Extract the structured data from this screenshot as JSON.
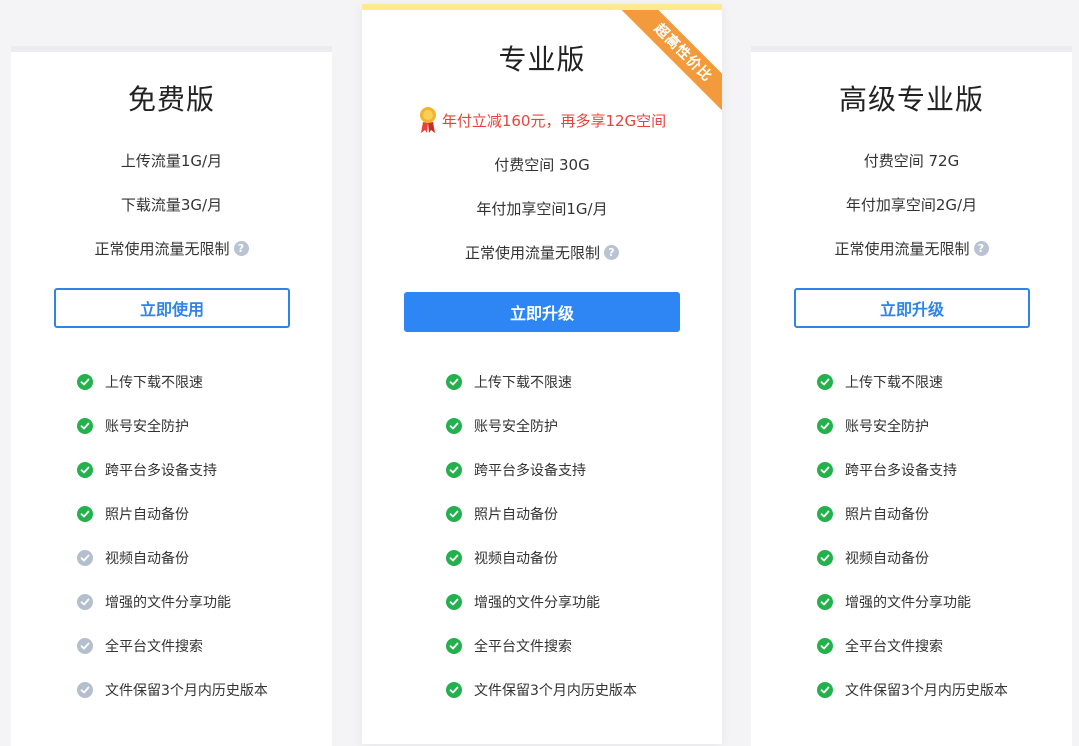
{
  "colors": {
    "accent": "#2e86f5",
    "check_on": "#22b14c",
    "check_off": "#b4bfcd",
    "promo": "#e8423a",
    "ribbon": "#f39a3c",
    "mid_top_border": "#fde98f"
  },
  "plans": [
    {
      "title": "免费版",
      "lines": [
        "上传流量1G/月",
        "下载流量3G/月",
        "正常使用流量无限制"
      ],
      "button": "立即使用",
      "features": [
        {
          "label": "上传下载不限速",
          "included": true
        },
        {
          "label": "账号安全防护",
          "included": true
        },
        {
          "label": "跨平台多设备支持",
          "included": true
        },
        {
          "label": "照片自动备份",
          "included": true
        },
        {
          "label": "视频自动备份",
          "included": false
        },
        {
          "label": "增强的文件分享功能",
          "included": false
        },
        {
          "label": "全平台文件搜索",
          "included": false
        },
        {
          "label": "文件保留3个月内历史版本",
          "included": false
        }
      ]
    },
    {
      "title": "专业版",
      "ribbon": "超高性价比",
      "promo": "年付立减160元，再多享12G空间",
      "lines": [
        "付费空间 30G",
        "年付加享空间1G/月",
        "正常使用流量无限制"
      ],
      "button": "立即升级",
      "features": [
        {
          "label": "上传下载不限速",
          "included": true
        },
        {
          "label": "账号安全防护",
          "included": true
        },
        {
          "label": "跨平台多设备支持",
          "included": true
        },
        {
          "label": "照片自动备份",
          "included": true
        },
        {
          "label": "视频自动备份",
          "included": true
        },
        {
          "label": "增强的文件分享功能",
          "included": true
        },
        {
          "label": "全平台文件搜索",
          "included": true
        },
        {
          "label": "文件保留3个月内历史版本",
          "included": true
        }
      ]
    },
    {
      "title": "高级专业版",
      "lines": [
        "付费空间 72G",
        "年付加享空间2G/月",
        "正常使用流量无限制"
      ],
      "button": "立即升级",
      "features": [
        {
          "label": "上传下载不限速",
          "included": true
        },
        {
          "label": "账号安全防护",
          "included": true
        },
        {
          "label": "跨平台多设备支持",
          "included": true
        },
        {
          "label": "照片自动备份",
          "included": true
        },
        {
          "label": "视频自动备份",
          "included": true
        },
        {
          "label": "增强的文件分享功能",
          "included": true
        },
        {
          "label": "全平台文件搜索",
          "included": true
        },
        {
          "label": "文件保留3个月内历史版本",
          "included": true
        }
      ]
    }
  ]
}
